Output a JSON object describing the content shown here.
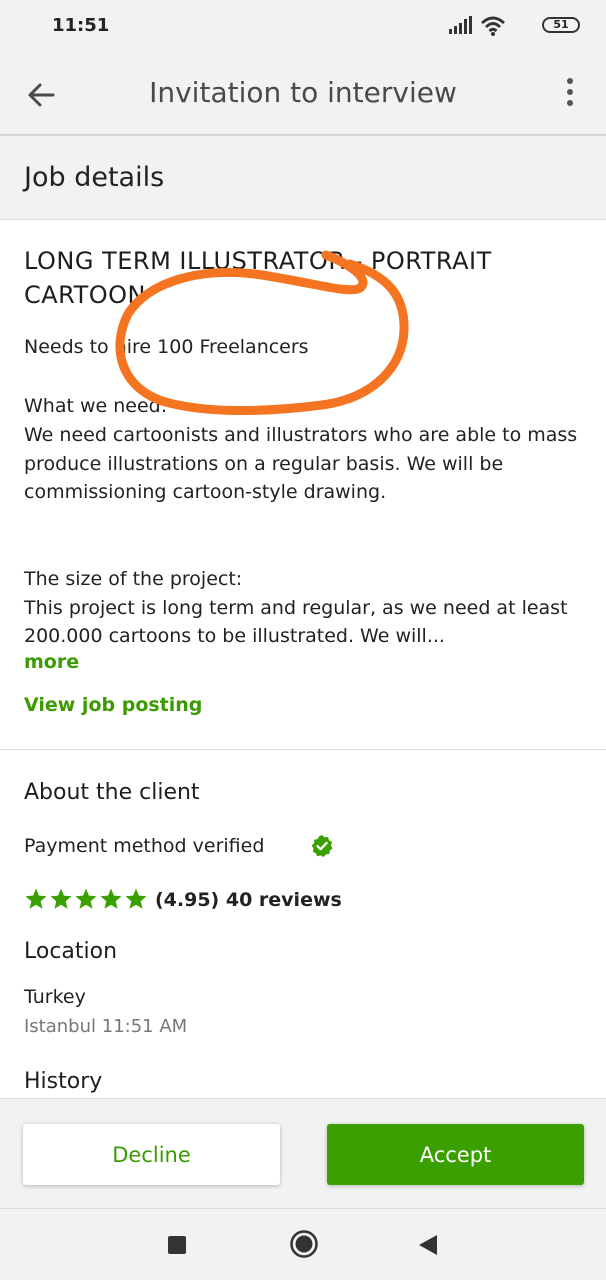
{
  "status_bar": {
    "time": "11:51",
    "battery": "51"
  },
  "app_bar": {
    "title": "Invitation to interview"
  },
  "section": {
    "job_details_label": "Job details"
  },
  "job": {
    "title": "LONG TERM ILLUSTRATOR - PORTRAIT CARTOON",
    "hire_text": "Needs to hire 100 Freelancers",
    "description": "What we need:\nWe need cartoonists and illustrators who are able to mass produce illustrations on a regular basis. We will be commissioning cartoon-style drawing.\n\n\nThe size of the project:\nThis project is long term and regular, as we need at least 200.000 cartoons to be illustrated. We will...",
    "more_label": "more",
    "view_posting_label": "View job posting"
  },
  "client": {
    "about_title": "About the client",
    "payment_text": "Payment method verified",
    "rating_value": 4.95,
    "rating_text": "(4.95) 40 reviews",
    "location_title": "Location",
    "country": "Turkey",
    "city_time": "Istanbul 11:51 AM",
    "history_title": "History"
  },
  "actions": {
    "decline_label": "Decline",
    "accept_label": "Accept"
  },
  "colors": {
    "accent_green": "#3b9b00",
    "button_green": "#39a000",
    "annotation_orange": "#f47421"
  },
  "icons": [
    "signal-icon",
    "wifi-icon",
    "battery-icon",
    "back-arrow-icon",
    "more-vertical-icon",
    "verified-check-icon",
    "star-icon",
    "nav-recents-icon",
    "nav-home-icon",
    "nav-back-icon"
  ]
}
